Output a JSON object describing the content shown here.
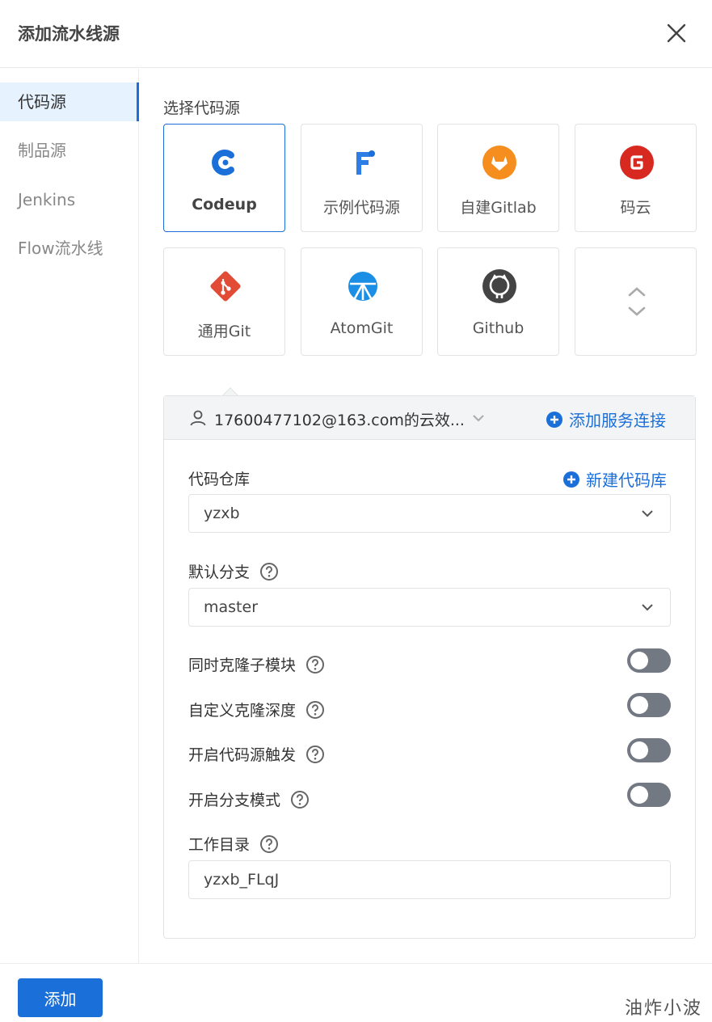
{
  "header": {
    "title": "添加流水线源"
  },
  "sidebar": {
    "items": [
      {
        "label": "代码源"
      },
      {
        "label": "制品源"
      },
      {
        "label": "Jenkins"
      },
      {
        "label": "Flow流水线"
      }
    ]
  },
  "source_section": {
    "label": "选择代码源",
    "tiles": [
      {
        "label": "Codeup",
        "icon": "codeup-logo-icon"
      },
      {
        "label": "示例代码源",
        "icon": "sample-source-logo-icon"
      },
      {
        "label": "自建Gitlab",
        "icon": "gitlab-logo-icon"
      },
      {
        "label": "码云",
        "icon": "gitee-logo-icon"
      },
      {
        "label": "通用Git",
        "icon": "git-logo-icon"
      },
      {
        "label": "AtomGit",
        "icon": "atomgit-logo-icon"
      },
      {
        "label": "Github",
        "icon": "github-logo-icon"
      },
      {
        "label": "",
        "icon": "expand-updown-icon"
      }
    ],
    "selected": "Codeup"
  },
  "connection": {
    "account": "17600477102@163.com的云效...",
    "add_link": "添加服务连接"
  },
  "form": {
    "repo_label": "代码仓库",
    "new_repo_link": "新建代码库",
    "repo_value": "yzxb",
    "branch_label": "默认分支",
    "branch_value": "master",
    "toggles": [
      {
        "label": "同时克隆子模块",
        "on": false
      },
      {
        "label": "自定义克隆深度",
        "on": false
      },
      {
        "label": "开启代码源触发",
        "on": false
      },
      {
        "label": "开启分支模式",
        "on": false
      }
    ],
    "workdir_label": "工作目录",
    "workdir_value": "yzxb_FLqJ"
  },
  "footer": {
    "add_button": "添加",
    "watermark": "油炸小波"
  },
  "colors": {
    "primary": "#1b6fd8",
    "active_bg": "#e6f2fe",
    "toggle_off": "#737982",
    "gitlab_orange": "#f68d1f",
    "gitee_red": "#d7291f",
    "git_red": "#e24c36"
  }
}
